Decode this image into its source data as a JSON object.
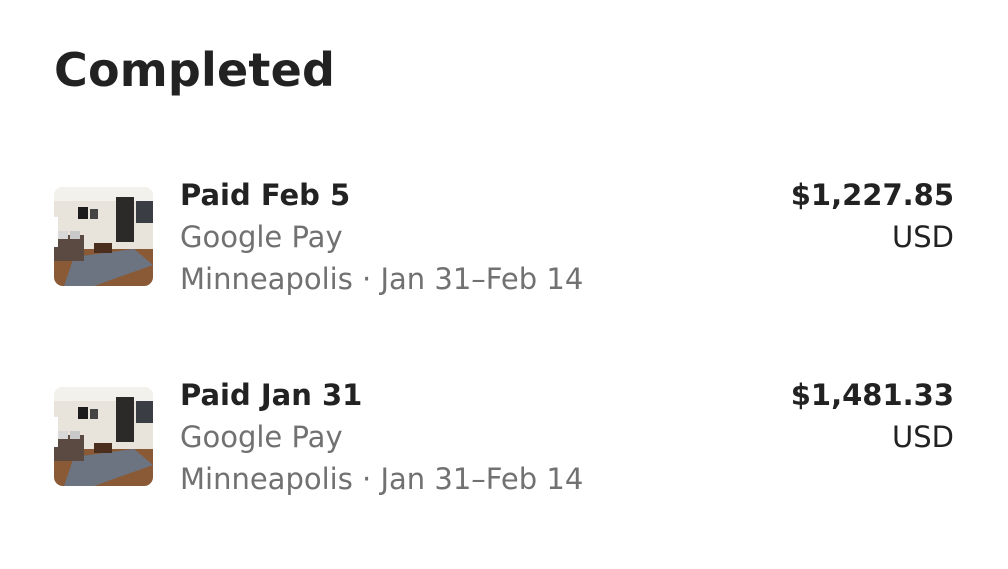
{
  "header": {
    "title": "Completed"
  },
  "payments": [
    {
      "title": "Paid Feb 5",
      "method": "Google Pay",
      "trip": "Minneapolis · Jan 31–Feb 14",
      "amount": "$1,227.85",
      "currency": "USD"
    },
    {
      "title": "Paid Jan 31",
      "method": "Google Pay",
      "trip": "Minneapolis · Jan 31–Feb 14",
      "amount": "$1,481.33",
      "currency": "USD"
    }
  ],
  "colors": {
    "primary_text": "#222222",
    "secondary_text": "#717171",
    "background": "#ffffff"
  }
}
